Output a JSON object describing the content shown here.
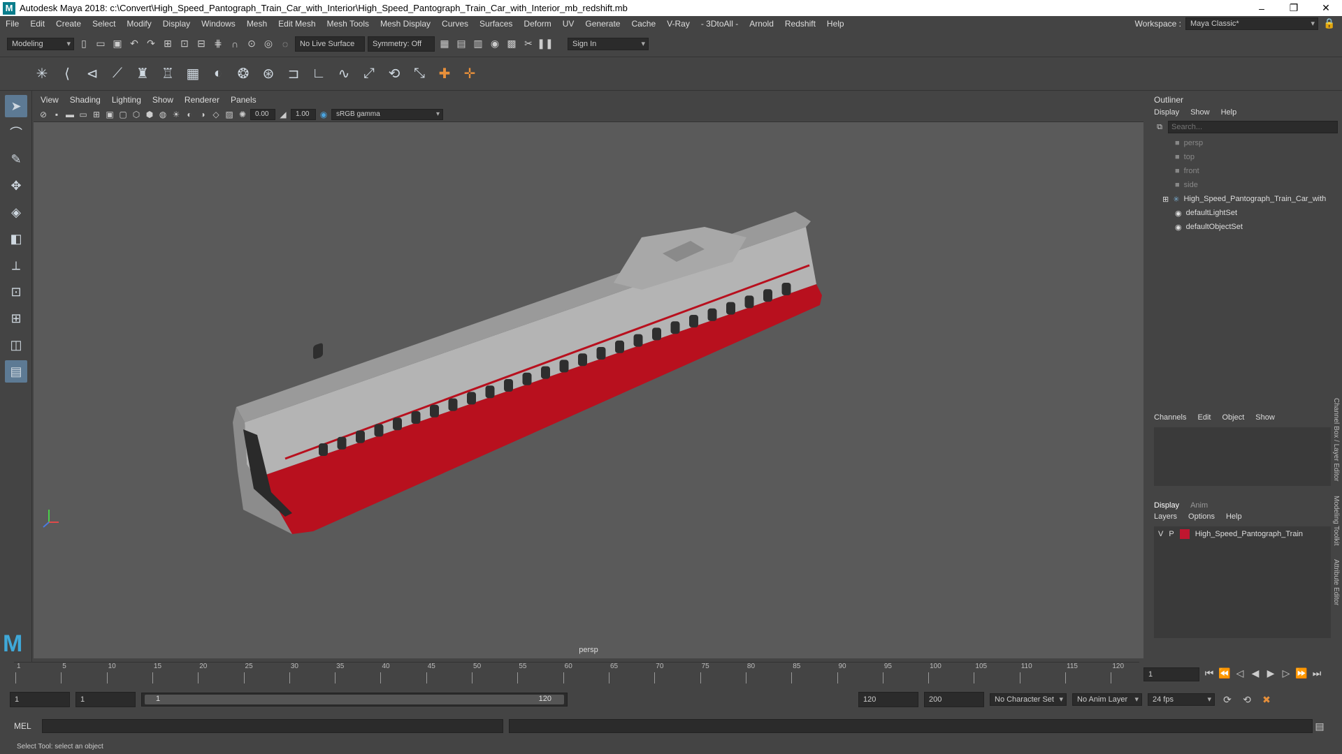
{
  "window": {
    "title": "Autodesk Maya 2018: c:\\Convert\\High_Speed_Pantograph_Train_Car_with_Interior\\High_Speed_Pantograph_Train_Car_with_Interior_mb_redshift.mb",
    "controls": [
      "–",
      "❐",
      "✕"
    ]
  },
  "menubar": {
    "items": [
      "File",
      "Edit",
      "Create",
      "Select",
      "Modify",
      "Display",
      "Windows",
      "Mesh",
      "Edit Mesh",
      "Mesh Tools",
      "Mesh Display",
      "Curves",
      "Surfaces",
      "Deform",
      "UV",
      "Generate",
      "Cache",
      "V-Ray",
      "- 3DtoAll -",
      "Arnold",
      "Redshift",
      "Help"
    ],
    "workspace_label": "Workspace :",
    "workspace_value": "Maya Classic*"
  },
  "statusline": {
    "mode": "Modeling",
    "live_surface": "No Live Surface",
    "symmetry": "Symmetry: Off",
    "sign_in": "Sign In"
  },
  "viewport": {
    "menu": [
      "View",
      "Shading",
      "Lighting",
      "Show",
      "Renderer",
      "Panels"
    ],
    "exposure": "0.00",
    "gamma": "1.00",
    "color_space": "sRGB gamma",
    "camera_label": "persp"
  },
  "outliner": {
    "title": "Outliner",
    "menu": [
      "Display",
      "Show",
      "Help"
    ],
    "search_placeholder": "Search...",
    "items": [
      {
        "label": "persp",
        "icon": "camera-icon",
        "dim": true
      },
      {
        "label": "top",
        "icon": "camera-icon",
        "dim": true
      },
      {
        "label": "front",
        "icon": "camera-icon",
        "dim": true
      },
      {
        "label": "side",
        "icon": "camera-icon",
        "dim": true
      },
      {
        "label": "High_Speed_Pantograph_Train_Car_with",
        "icon": "group-icon",
        "dim": false
      },
      {
        "label": "defaultLightSet",
        "icon": "set-icon",
        "dim": false
      },
      {
        "label": "defaultObjectSet",
        "icon": "set-icon",
        "dim": false
      }
    ]
  },
  "channelbox": {
    "menu": [
      "Channels",
      "Edit",
      "Object",
      "Show"
    ]
  },
  "layers": {
    "tabs": [
      "Display",
      "Anim"
    ],
    "menu": [
      "Layers",
      "Options",
      "Help"
    ],
    "row": {
      "v": "V",
      "p": "P",
      "name": "High_Speed_Pantograph_Train",
      "color": "#c0162f"
    }
  },
  "side_tabs": [
    "Channel Box / Layer Editor",
    "Modeling Toolkit",
    "Attribute Editor"
  ],
  "timeline": {
    "ticks": [
      "1",
      "5",
      "10",
      "15",
      "20",
      "25",
      "30",
      "35",
      "40",
      "45",
      "50",
      "55",
      "60",
      "65",
      "70",
      "75",
      "80",
      "85",
      "90",
      "95",
      "100",
      "105",
      "110",
      "115",
      "120"
    ],
    "current_frame": "1"
  },
  "range": {
    "start": "1",
    "playback_start": "1",
    "slider_start": "1",
    "slider_end": "120",
    "playback_end": "120",
    "end": "200",
    "character_set": "No Character Set",
    "anim_layer": "No Anim Layer",
    "fps": "24 fps"
  },
  "mel": {
    "label": "MEL"
  },
  "helpline": {
    "text": "Select Tool: select an object"
  }
}
